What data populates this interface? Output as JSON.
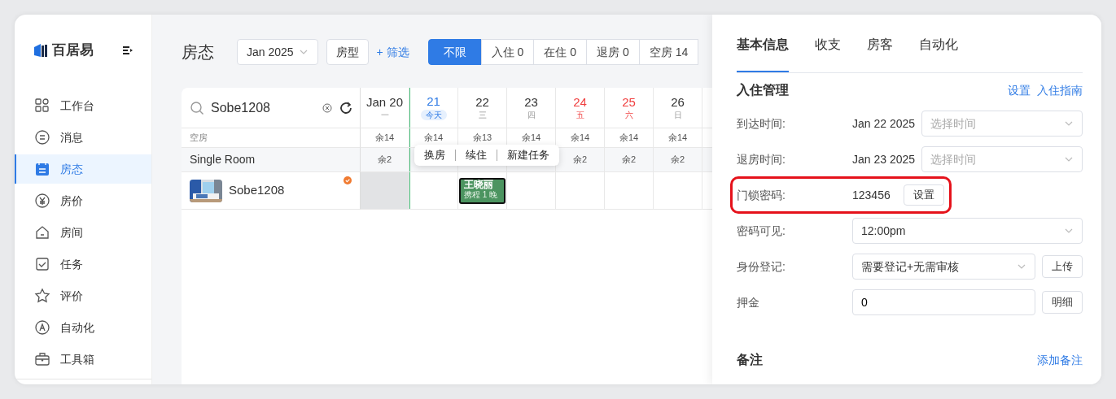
{
  "sidebar": {
    "brand": "百居易",
    "items": [
      {
        "label": "工作台",
        "selected": false
      },
      {
        "label": "消息",
        "selected": false
      },
      {
        "label": "房态",
        "selected": true
      },
      {
        "label": "房价",
        "selected": false
      },
      {
        "label": "房间",
        "selected": false
      },
      {
        "label": "任务",
        "selected": false
      },
      {
        "label": "评价",
        "selected": false
      },
      {
        "label": "自动化",
        "selected": false
      },
      {
        "label": "工具箱",
        "selected": false
      }
    ]
  },
  "main": {
    "title": "房态",
    "month": "Jan 2025",
    "room_type_button": "房型",
    "filter_link": "+ 筛选",
    "status_filters": [
      {
        "label": "不限",
        "selected": true
      },
      {
        "label": "入住 0",
        "selected": false
      },
      {
        "label": "在住 0",
        "selected": false
      },
      {
        "label": "退房 0",
        "selected": false
      },
      {
        "label": "空房 14",
        "selected": false
      }
    ],
    "search": {
      "value": "Sobe1208"
    },
    "vacancy_label": "空房",
    "room_type": "Single Room",
    "room": {
      "name": "Sobe1208",
      "flagged": true
    },
    "days": [
      {
        "date": "Jan 20",
        "weekday": "一",
        "today": false,
        "weekend": false,
        "past": true,
        "vacancy": "余14",
        "type_vacancy": "余2"
      },
      {
        "date": "21",
        "weekday": "今天",
        "today": true,
        "weekend": false,
        "past": false,
        "vacancy": "余14"
      },
      {
        "date": "22",
        "weekday": "三",
        "today": false,
        "weekend": false,
        "past": false,
        "vacancy": "余13",
        "booking": {
          "guest": "王晓丽",
          "source": "携程 1 晚"
        }
      },
      {
        "date": "23",
        "weekday": "四",
        "today": false,
        "weekend": false,
        "past": false,
        "vacancy": "余14"
      },
      {
        "date": "24",
        "weekday": "五",
        "today": false,
        "weekend": true,
        "past": false,
        "vacancy": "余14",
        "type_vacancy": "余2"
      },
      {
        "date": "25",
        "weekday": "六",
        "today": false,
        "weekend": true,
        "past": false,
        "vacancy": "余14",
        "type_vacancy": "余2"
      },
      {
        "date": "26",
        "weekday": "日",
        "today": false,
        "weekend": false,
        "past": false,
        "vacancy": "余14",
        "type_vacancy": "余2"
      }
    ],
    "popup_menu": [
      "换房",
      "续住",
      "新建任务"
    ]
  },
  "panel": {
    "tabs": [
      {
        "label": "基本信息",
        "selected": true
      },
      {
        "label": "收支",
        "selected": false
      },
      {
        "label": "房客",
        "selected": false
      },
      {
        "label": "自动化",
        "selected": false
      }
    ],
    "section_title": "入住管理",
    "section_links": [
      "设置",
      "入住指南"
    ],
    "rows": [
      {
        "kind": "time",
        "label": "到达时间:",
        "value": "Jan 22 2025",
        "placeholder": "选择时间",
        "highlighted": false
      },
      {
        "kind": "time",
        "label": "退房时间:",
        "value": "Jan 23 2025",
        "placeholder": "选择时间",
        "highlighted": false
      },
      {
        "kind": "code",
        "label": "门锁密码:",
        "value": "123456",
        "button": "设置",
        "highlighted": true
      },
      {
        "kind": "select",
        "label": "密码可见:",
        "value": "12:00pm",
        "highlighted": false
      },
      {
        "kind": "select",
        "label": "身份登记:",
        "value": "需要登记+无需审核",
        "button": "上传",
        "highlighted": false
      },
      {
        "kind": "input",
        "label": "押金",
        "value": "0",
        "button": "明细",
        "highlighted": false
      }
    ],
    "notes_title": "备注",
    "notes_link": "添加备注"
  }
}
